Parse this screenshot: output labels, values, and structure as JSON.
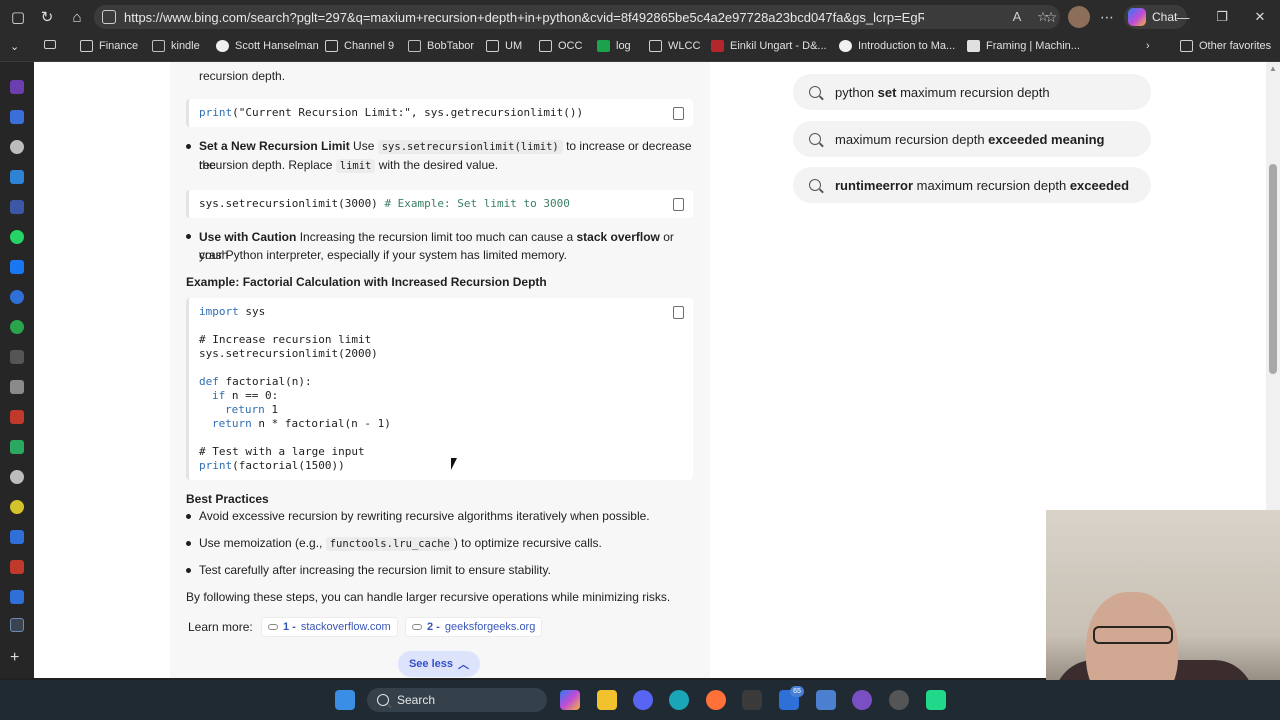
{
  "browser": {
    "url": "https://www.bing.com/search?pglt=297&q=maxium+recursion+depth+in+python&cvid=8f492865be5c4a2e97728a23bcd047fa&gs_lcrp=EgRlZGdlKgYIAB...",
    "chat_label": "Chat"
  },
  "favorites": {
    "items": [
      "Finance",
      "kindle",
      "Scott Hanselman",
      "Channel 9",
      "BobTabor",
      "UM",
      "OCC",
      "log",
      "WLCC",
      "Einkil Ungart - D&...",
      "Introduction to Ma...",
      "Framing | Machin..."
    ],
    "other": "Other favorites"
  },
  "answer": {
    "intro_tail": "recursion depth.",
    "code1_func": "print",
    "code1_args": "(\"Current Recursion Limit:\", sys.getrecursionlimit())",
    "set_limit_title": "Set a New Recursion Limit",
    "set_limit_use": "Use",
    "set_limit_code": "sys.setrecursionlimit(limit)",
    "set_limit_rest": "to increase or decrease the",
    "set_limit_line2a": "recursion depth. Replace",
    "set_limit_code2": "limit",
    "set_limit_line2b": "with the desired value.",
    "code2_main": "sys.setrecursionlimit(3000)",
    "code2_comment": "# Example: Set limit to 3000",
    "caution_title": "Use with Caution",
    "caution_text1": "Increasing the recursion limit too much can cause a",
    "caution_bold": "stack overflow",
    "caution_text2": "or crash",
    "caution_line2": "your Python interpreter, especially if your system has limited memory.",
    "example_heading": "Example: Factorial Calculation with Increased Recursion Depth",
    "code3": {
      "l1_kw": "import",
      "l1": " sys",
      "l2": "# Increase recursion limit",
      "l3": "sys.setrecursionlimit(2000)",
      "l4_kw": "def",
      "l4": " factorial(n):",
      "l5_kw": "if",
      "l5": " n == 0:",
      "l6_kw": "return",
      "l6": " 1",
      "l7_kw": "return",
      "l7": " n * factorial(n - 1)",
      "l8": "# Test with a large input",
      "l9_kw": "print",
      "l9": "(factorial(1500))"
    },
    "best_heading": "Best Practices",
    "bp1": "Avoid excessive recursion by rewriting recursive algorithms iteratively when possible.",
    "bp2a": "Use memoization (e.g.,",
    "bp2_code": "functools.lru_cache",
    "bp2b": ") to optimize recursive calls.",
    "bp3": "Test carefully after increasing the recursion limit to ensure stability.",
    "closing": "By following these steps, you can handle larger recursive operations while minimizing risks.",
    "learn_more": "Learn more:",
    "sources": [
      {
        "num": "1 -",
        "site": "stackoverflow.com"
      },
      {
        "num": "2 -",
        "site": "geeksforgeeks.org"
      }
    ],
    "see_less": "See less"
  },
  "related": [
    {
      "a": "python ",
      "b": "set",
      "c": " maximum recursion depth",
      "d": ""
    },
    {
      "a": "maximum recursion depth ",
      "b": "exceeded meaning",
      "c": "",
      "d": ""
    },
    {
      "a": "",
      "b": "runtimeerror",
      "c": " maximum recursion depth ",
      "d": "exceeded"
    }
  ],
  "taskbar": {
    "search_label": "Search",
    "badge": "65"
  },
  "colors": {
    "accent": "#3550c8",
    "code_keyword": "#2f6fb5",
    "code_comment": "#3c7f64",
    "answer_bg": "#f7f7f7"
  }
}
